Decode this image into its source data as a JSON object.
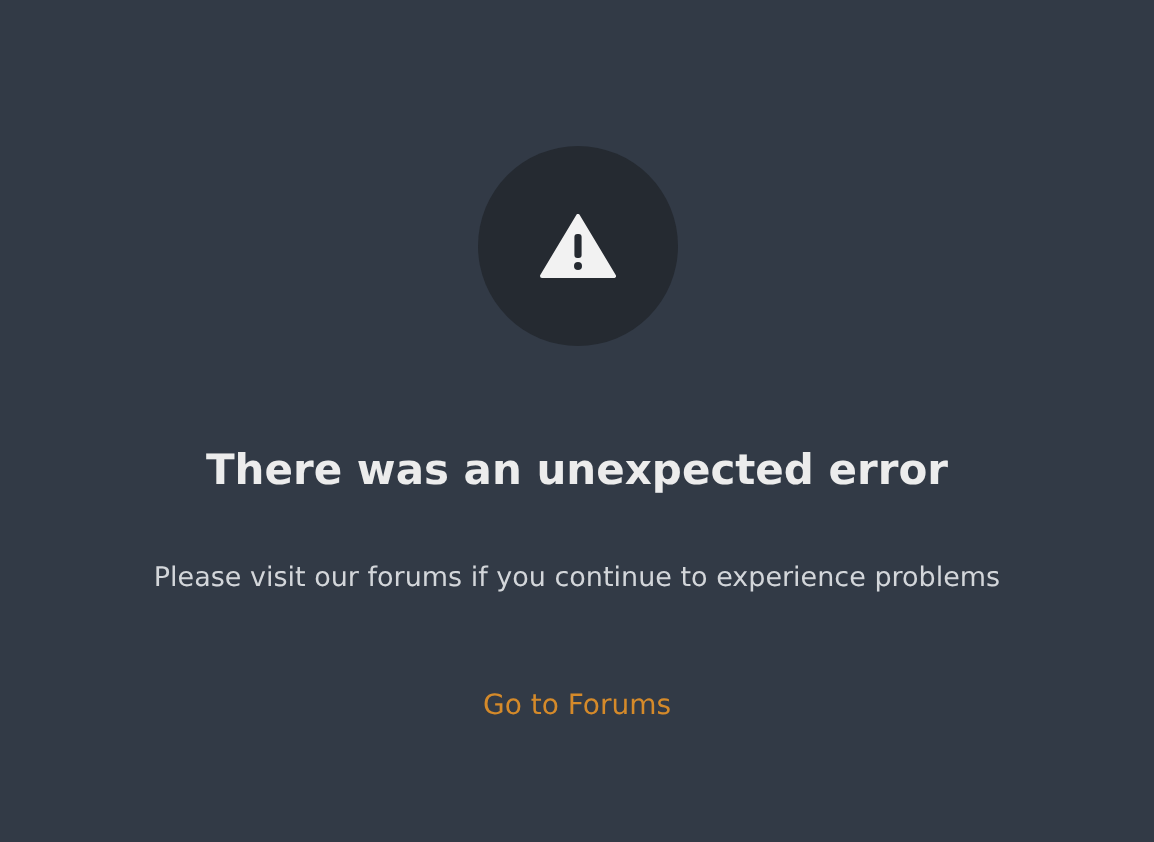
{
  "error": {
    "title": "There was an unexpected error",
    "message": "Please visit our forums if you continue to experience problems",
    "link": "Go to Forums"
  }
}
